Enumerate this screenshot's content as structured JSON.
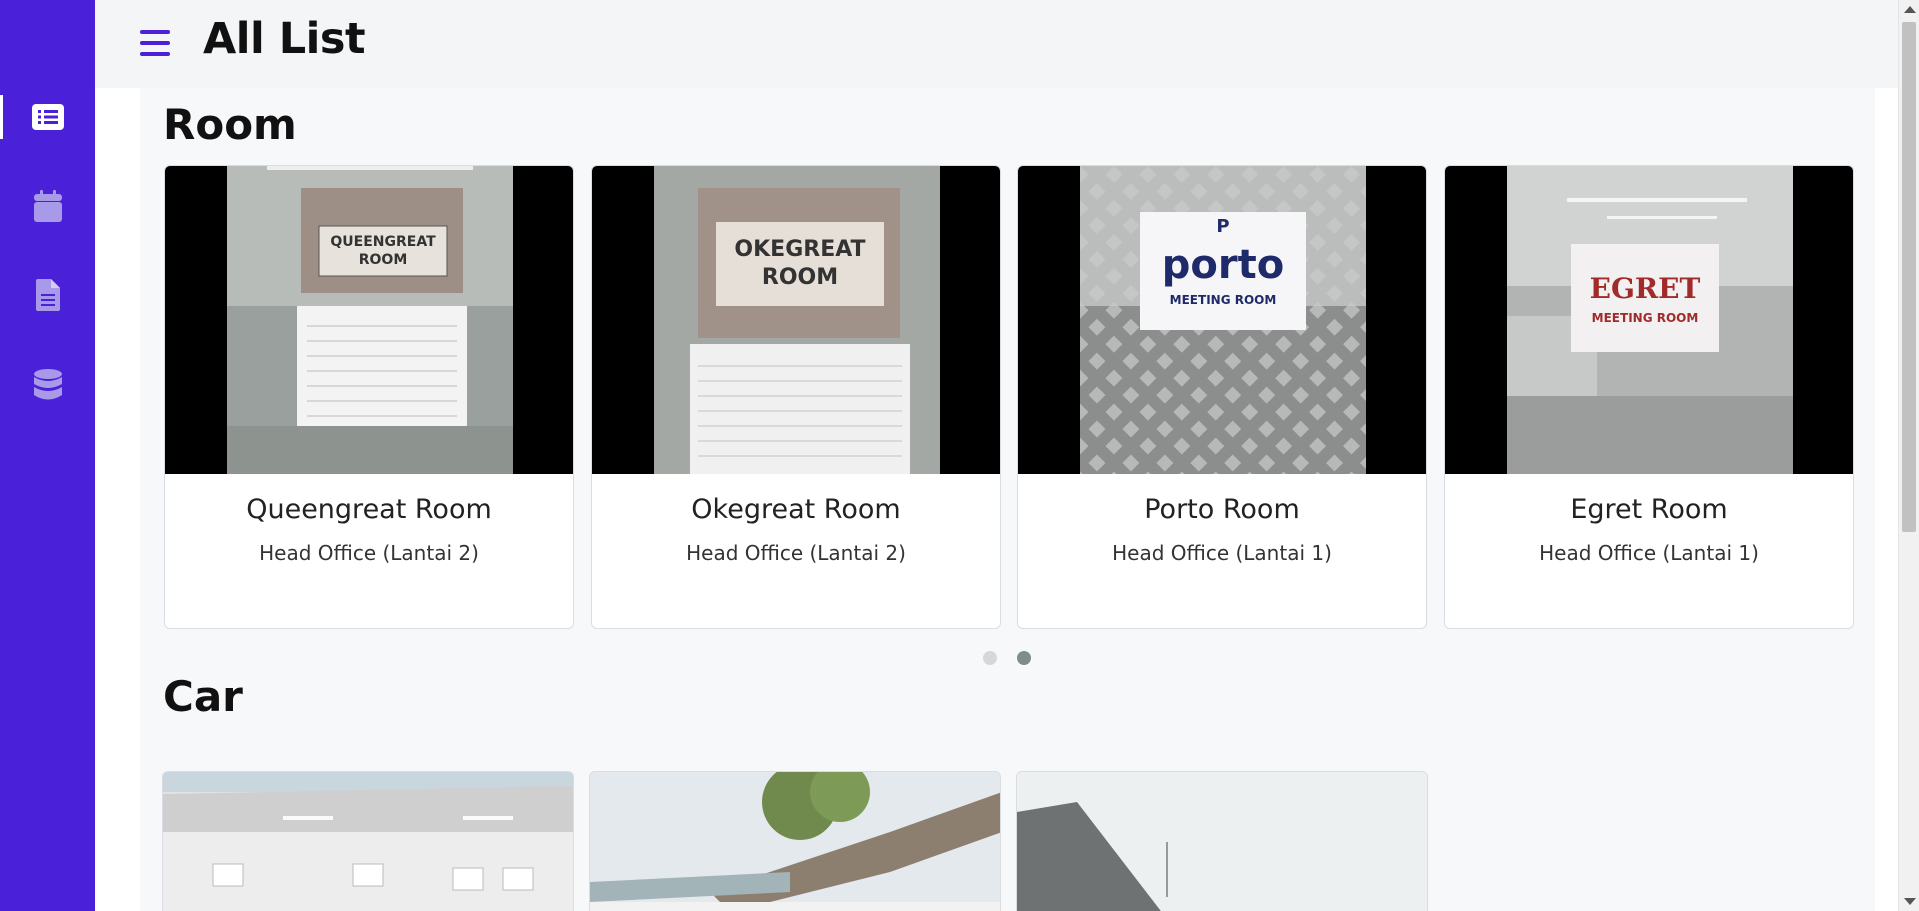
{
  "header": {
    "title": "All List"
  },
  "sidebar": {
    "items": [
      {
        "icon": "list-icon",
        "active": true
      },
      {
        "icon": "calendar-icon",
        "active": false
      },
      {
        "icon": "document-icon",
        "active": false
      },
      {
        "icon": "database-icon",
        "active": false
      }
    ]
  },
  "rooms": {
    "heading": "Room",
    "items": [
      {
        "name": "Queengreat Room",
        "location": "Head Office (Lantai 2)",
        "sign": "QUEENGREAT ROOM"
      },
      {
        "name": "Okegreat Room",
        "location": "Head Office (Lantai 2)",
        "sign": "OKEGREAT ROOM"
      },
      {
        "name": "Porto Room",
        "location": "Head Office (Lantai 1)",
        "sign": "porto MEETING ROOM"
      },
      {
        "name": "Egret Room",
        "location": "Head Office (Lantai 1)",
        "sign": "EGRET MEETING ROOM"
      }
    ],
    "carousel": {
      "pages": 2,
      "active_page": 2
    }
  },
  "cars": {
    "heading": "Car",
    "count_visible": 3
  },
  "colors": {
    "sidebar": "#4a20d9",
    "accent": "#4a20d9",
    "header_bg": "#f4f5f7",
    "main_bg": "#f7f8fa"
  }
}
